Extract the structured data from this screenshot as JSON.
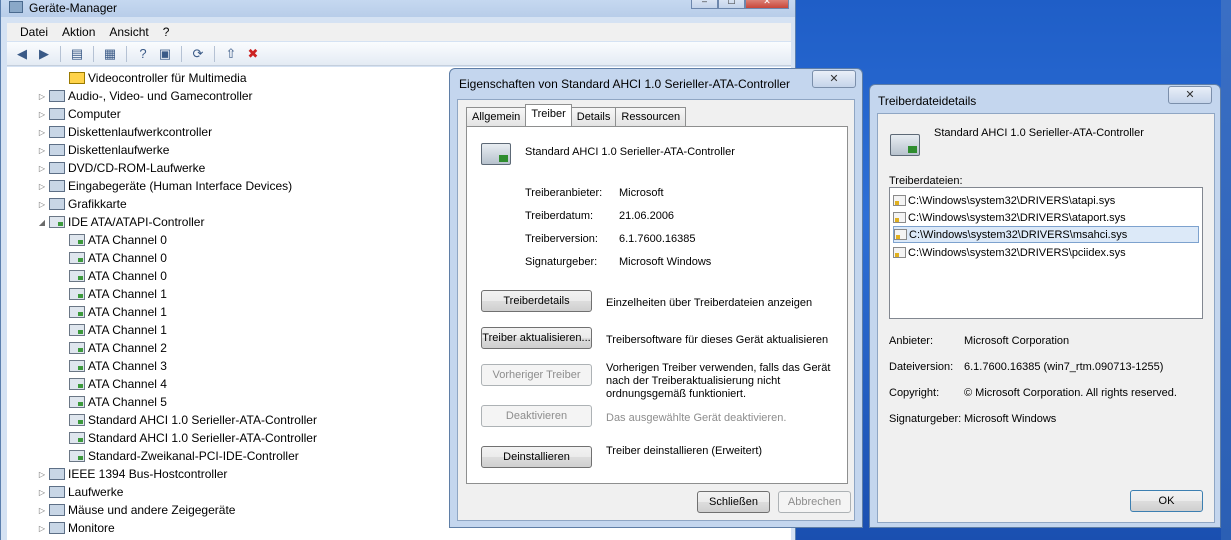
{
  "device_manager": {
    "title": "Geräte-Manager",
    "window_buttons": {
      "minimize": "–",
      "maximize": "☐",
      "close": "✕"
    },
    "menu": [
      "Datei",
      "Aktion",
      "Ansicht",
      "?"
    ],
    "toolbar_icons": [
      "back-arrow-icon",
      "forward-arrow-icon",
      "console-tree-icon",
      "properties-icon",
      "help-icon",
      "show-hide-icon",
      "scan-hardware-icon",
      "update-driver-icon",
      "uninstall-icon"
    ],
    "tree": [
      {
        "label": "Videocontroller für Multimedia",
        "level": 2,
        "icon": "warning-device-icon",
        "expander": ""
      },
      {
        "label": "Audio-, Video- und Gamecontroller",
        "level": 1,
        "icon": "audio-icon",
        "expander": "▷"
      },
      {
        "label": "Computer",
        "level": 1,
        "icon": "computer-icon",
        "expander": "▷"
      },
      {
        "label": "Diskettenlaufwerkcontroller",
        "level": 1,
        "icon": "floppy-controller-icon",
        "expander": "▷"
      },
      {
        "label": "Diskettenlaufwerke",
        "level": 1,
        "icon": "floppy-icon",
        "expander": "▷"
      },
      {
        "label": "DVD/CD-ROM-Laufwerke",
        "level": 1,
        "icon": "dvd-icon",
        "expander": "▷"
      },
      {
        "label": "Eingabegeräte (Human Interface Devices)",
        "level": 1,
        "icon": "hid-icon",
        "expander": "▷"
      },
      {
        "label": "Grafikkarte",
        "level": 1,
        "icon": "display-adapter-icon",
        "expander": "▷"
      },
      {
        "label": "IDE ATA/ATAPI-Controller",
        "level": 1,
        "icon": "ide-controller-icon",
        "expander": "◢"
      },
      {
        "label": "ATA Channel 0",
        "level": 2,
        "icon": "ide-channel-icon",
        "expander": ""
      },
      {
        "label": "ATA Channel 0",
        "level": 2,
        "icon": "ide-channel-icon",
        "expander": ""
      },
      {
        "label": "ATA Channel 0",
        "level": 2,
        "icon": "ide-channel-icon",
        "expander": ""
      },
      {
        "label": "ATA Channel 1",
        "level": 2,
        "icon": "ide-channel-icon",
        "expander": ""
      },
      {
        "label": "ATA Channel 1",
        "level": 2,
        "icon": "ide-channel-icon",
        "expander": ""
      },
      {
        "label": "ATA Channel 1",
        "level": 2,
        "icon": "ide-channel-icon",
        "expander": ""
      },
      {
        "label": "ATA Channel 2",
        "level": 2,
        "icon": "ide-channel-icon",
        "expander": ""
      },
      {
        "label": "ATA Channel 3",
        "level": 2,
        "icon": "ide-channel-icon",
        "expander": ""
      },
      {
        "label": "ATA Channel 4",
        "level": 2,
        "icon": "ide-channel-icon",
        "expander": ""
      },
      {
        "label": "ATA Channel 5",
        "level": 2,
        "icon": "ide-channel-icon",
        "expander": ""
      },
      {
        "label": "Standard AHCI 1.0 Serieller-ATA-Controller",
        "level": 2,
        "icon": "ide-channel-icon",
        "expander": ""
      },
      {
        "label": "Standard AHCI 1.0 Serieller-ATA-Controller",
        "level": 2,
        "icon": "ide-channel-icon",
        "expander": ""
      },
      {
        "label": "Standard-Zweikanal-PCI-IDE-Controller",
        "level": 2,
        "icon": "ide-channel-icon",
        "expander": ""
      },
      {
        "label": "IEEE 1394 Bus-Hostcontroller",
        "level": 1,
        "icon": "ieee1394-icon",
        "expander": "▷"
      },
      {
        "label": "Laufwerke",
        "level": 1,
        "icon": "disk-drive-icon",
        "expander": "▷"
      },
      {
        "label": "Mäuse und andere Zeigegeräte",
        "level": 1,
        "icon": "mouse-icon",
        "expander": "▷"
      },
      {
        "label": "Monitore",
        "level": 1,
        "icon": "monitor-icon",
        "expander": "▷"
      }
    ]
  },
  "properties_dialog": {
    "title": "Eigenschaften von Standard AHCI 1.0 Serieller-ATA-Controller",
    "close_glyph": "✕",
    "tabs": [
      "Allgemein",
      "Treiber",
      "Details",
      "Ressourcen"
    ],
    "active_tab": "Treiber",
    "device_name": "Standard AHCI 1.0 Serieller-ATA-Controller",
    "info": [
      {
        "label": "Treiberanbieter:",
        "value": "Microsoft"
      },
      {
        "label": "Treiberdatum:",
        "value": "21.06.2006"
      },
      {
        "label": "Treiberversion:",
        "value": "6.1.7600.16385"
      },
      {
        "label": "Signaturgeber:",
        "value": "Microsoft Windows"
      }
    ],
    "actions": [
      {
        "button": "Treiberdetails",
        "description": "Einzelheiten über Treiberdateien anzeigen",
        "enabled": true
      },
      {
        "button": "Treiber aktualisieren...",
        "description": "Treibersoftware für dieses Gerät aktualisieren",
        "enabled": true
      },
      {
        "button": "Vorheriger Treiber",
        "description": "Vorherigen Treiber verwenden, falls das Gerät nach der Treiberaktualisierung nicht ordnungsgemäß funktioniert.",
        "enabled": false
      },
      {
        "button": "Deaktivieren",
        "description": "Das ausgewählte Gerät deaktivieren.",
        "enabled": false
      },
      {
        "button": "Deinstallieren",
        "description": "Treiber deinstallieren (Erweitert)",
        "enabled": true
      }
    ],
    "footer": {
      "close": "Schließen",
      "cancel": "Abbrechen"
    }
  },
  "details_dialog": {
    "title": "Treiberdateidetails",
    "close_glyph": "✕",
    "device_name": "Standard AHCI 1.0 Serieller-ATA-Controller",
    "files_label": "Treiberdateien:",
    "files": [
      "C:\\Windows\\system32\\DRIVERS\\atapi.sys",
      "C:\\Windows\\system32\\DRIVERS\\ataport.sys",
      "C:\\Windows\\system32\\DRIVERS\\msahci.sys",
      "C:\\Windows\\system32\\DRIVERS\\pciidex.sys"
    ],
    "selected_file": 2,
    "info": [
      {
        "label": "Anbieter:",
        "value": "Microsoft Corporation"
      },
      {
        "label": "Dateiversion:",
        "value": "6.1.7600.16385 (win7_rtm.090713-1255)"
      },
      {
        "label": "Copyright:",
        "value": "© Microsoft Corporation. All rights reserved."
      },
      {
        "label": "Signaturgeber:",
        "value": "Microsoft Windows"
      }
    ],
    "ok": "OK"
  }
}
